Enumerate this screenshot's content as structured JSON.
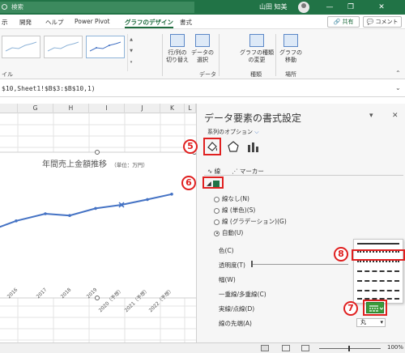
{
  "titlebar": {
    "search_label": "検索",
    "user_name": "山田 知美",
    "window_buttons": [
      "—",
      "❐",
      "✕"
    ]
  },
  "ribbon_tabs": [
    {
      "label": "示"
    },
    {
      "label": "開発"
    },
    {
      "label": "ヘルプ"
    },
    {
      "label": "Power Pivot"
    },
    {
      "label": "グラフのデザイン",
      "active": true
    },
    {
      "label": "書式"
    }
  ],
  "header_buttons": {
    "share": "🔗 共有",
    "comments": "💬 コメント"
  },
  "ribbon": {
    "style_group_label": "イル",
    "data_group": {
      "label": "データ",
      "switch_row_col": "行/列の\n切り替え",
      "select_data": "データの\n選択"
    },
    "type_group": {
      "label": "種類",
      "change_type": "グラフの種類\nの変更"
    },
    "location_group": {
      "label": "場所",
      "move_chart": "グラフの\n移動"
    }
  },
  "formula_bar": {
    "text": "$10,Sheet1!$B$3:$B$10,1)"
  },
  "column_headers": [
    "G",
    "H",
    "I",
    "J",
    "K",
    "L"
  ],
  "chart": {
    "title": "年間売上金額推移",
    "unit": "（単位：万円）"
  },
  "chart_data": {
    "type": "line",
    "title": "年間売上金額推移",
    "categories": [
      "2016",
      "2017",
      "2018",
      "2019",
      "2020（予想）",
      "2021（予想）",
      "2022（予想）"
    ],
    "series": [
      {
        "values": [
          52,
          60,
          58,
          66,
          70,
          76,
          82
        ]
      }
    ],
    "ylim": [
      0,
      100
    ],
    "color": "#4472c4"
  },
  "pane": {
    "title": "データ要素の書式設定",
    "series_options": "系列のオプション",
    "tabs": {
      "line": "線",
      "marker": "マーカー"
    },
    "line_section_options": [
      {
        "label": "線なし(N)"
      },
      {
        "label": "線 (単色)(S)"
      },
      {
        "label": "線 (グラデーション)(G)"
      },
      {
        "label": "自動(U)",
        "selected": true
      }
    ],
    "properties": [
      "色(C)",
      "透明度(T)",
      "幅(W)",
      "一重線/多重線(C)",
      "実線/点線(D)",
      "線の先端(A)"
    ],
    "end_cap_value": "丸"
  },
  "badges": [
    "5",
    "6",
    "7",
    "8"
  ],
  "statusbar": {
    "zoom": "100%"
  },
  "colors": {
    "excel_green": "#217346",
    "accent_red": "#e02020",
    "series_blue": "#4472c4"
  }
}
